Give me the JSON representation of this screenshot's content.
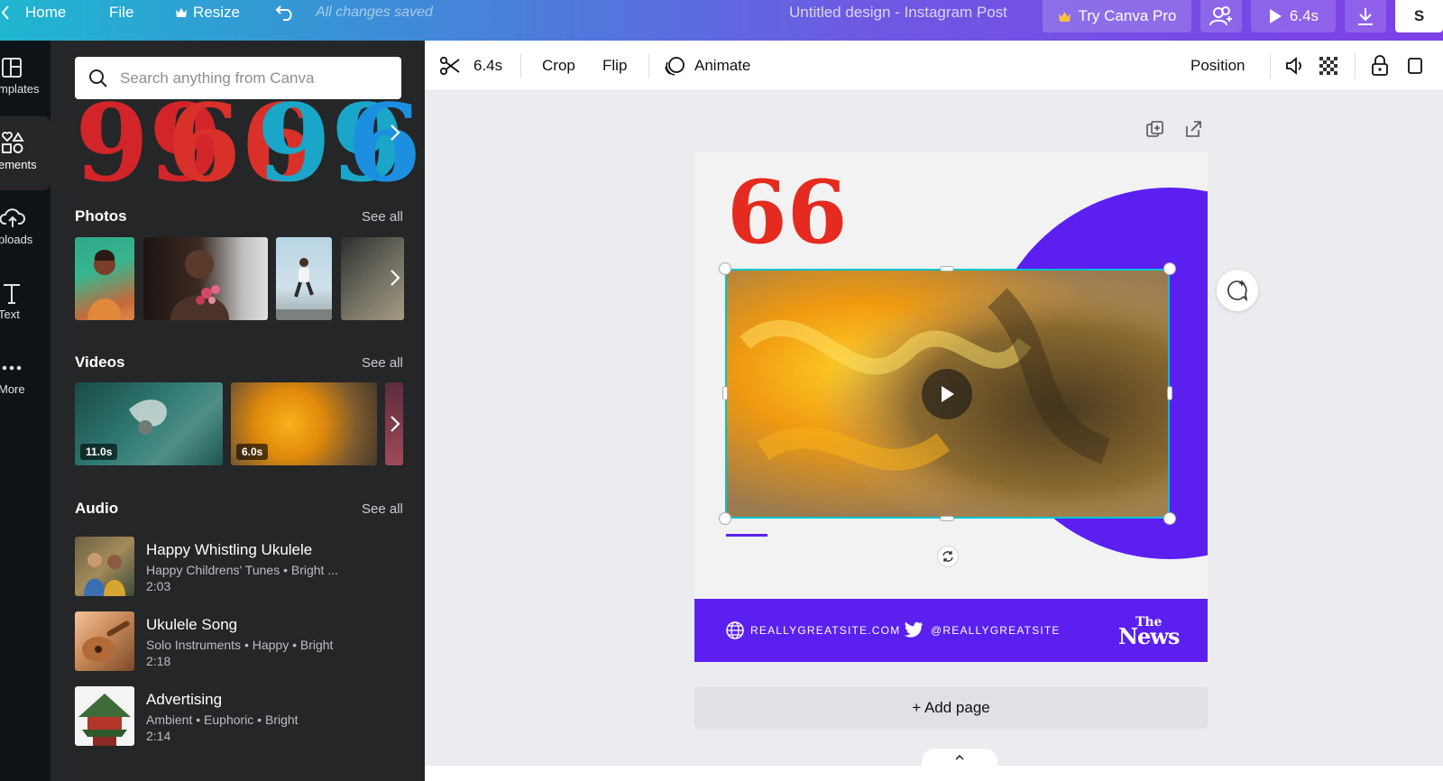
{
  "topbar": {
    "home": "Home",
    "file": "File",
    "resize": "Resize",
    "saved": "All changes saved",
    "title": "Untitled design - Instagram Post",
    "try_pro": "Try Canva Pro",
    "play_duration": "6.4s"
  },
  "rail": {
    "items": [
      {
        "label": "mplates",
        "icon": "templates-icon"
      },
      {
        "label": "ements",
        "icon": "elements-icon"
      },
      {
        "label": "ploads",
        "icon": "uploads-icon"
      },
      {
        "label": "Text",
        "icon": "text-icon"
      },
      {
        "label": "More",
        "icon": "more-icon"
      }
    ]
  },
  "panel": {
    "search_placeholder": "Search anything from Canva",
    "quote_glyphs": [
      {
        "char": "99",
        "color": "#d1252a"
      },
      {
        "char": "66",
        "color": "#d9312a"
      },
      {
        "char": "99",
        "color": "#1aa6c8"
      },
      {
        "char": "6",
        "color": "#1c8fe0"
      }
    ],
    "photos": {
      "title": "Photos",
      "see_all": "See all"
    },
    "videos": {
      "title": "Videos",
      "see_all": "See all",
      "items": [
        {
          "duration": "11.0s"
        },
        {
          "duration": "6.0s"
        }
      ]
    },
    "audio": {
      "title": "Audio",
      "see_all": "See all",
      "items": [
        {
          "title": "Happy Whistling Ukulele",
          "meta": "Happy Childrens' Tunes • Bright ...",
          "duration": "2:03"
        },
        {
          "title": "Ukulele Song",
          "meta": "Solo Instruments • Happy • Bright",
          "duration": "2:18"
        },
        {
          "title": "Advertising",
          "meta": "Ambient • Euphoric • Bright",
          "duration": "2:14"
        }
      ]
    }
  },
  "context_toolbar": {
    "duration": "6.4s",
    "crop": "Crop",
    "flip": "Flip",
    "animate": "Animate",
    "position": "Position"
  },
  "design": {
    "quote_mark": "66",
    "website": "REALLYGREATSITE.COM",
    "handle": "@REALLYGREATSITE",
    "logo_top": "The",
    "logo_bottom": "News",
    "accent_color": "#5b20f0",
    "quote_color": "#e52a1f",
    "selection_color": "#00c4cc"
  },
  "add_page": "+ Add page"
}
